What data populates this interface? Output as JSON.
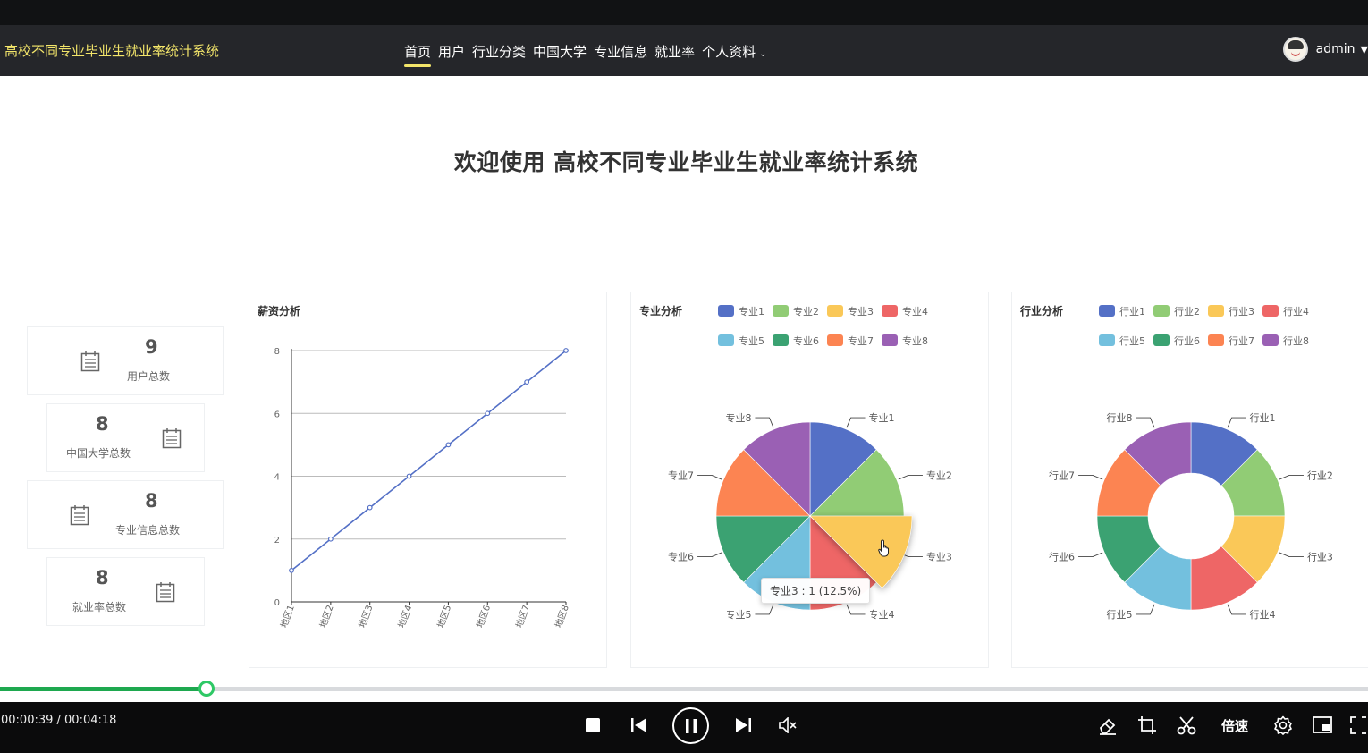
{
  "app": {
    "brand": "高校不同专业毕业生就业率统计系统",
    "welcome": "欢迎使用 高校不同专业毕业生就业率统计系统"
  },
  "nav": {
    "items": [
      "首页",
      "用户",
      "行业分类",
      "中国大学",
      "专业信息",
      "就业率",
      "个人资料"
    ],
    "active": "首页",
    "user": "admin"
  },
  "stats": [
    {
      "label": "用户总数",
      "value": "9",
      "icon": "calendar-icon"
    },
    {
      "label": "中国大学总数",
      "value": "8",
      "icon": "calendar-icon"
    },
    {
      "label": "专业信息总数",
      "value": "8",
      "icon": "calendar-icon"
    },
    {
      "label": "就业率总数",
      "value": "8",
      "icon": "calendar-icon"
    }
  ],
  "chart_data": [
    {
      "type": "line",
      "title": "薪资分析",
      "categories": [
        "地区1",
        "地区2",
        "地区3",
        "地区4",
        "地区5",
        "地区6",
        "地区7",
        "地区8"
      ],
      "values": [
        1,
        2,
        3,
        4,
        5,
        6,
        7,
        8
      ],
      "ylim": [
        0,
        8
      ],
      "yticks": [
        0,
        2,
        4,
        6,
        8
      ],
      "color": "#5470c6",
      "grid": true
    },
    {
      "type": "pie",
      "variant": "pie",
      "title": "专业分析",
      "categories": [
        "专业1",
        "专业2",
        "专业3",
        "专业4",
        "专业5",
        "专业6",
        "专业7",
        "专业8"
      ],
      "values": [
        1,
        1,
        1,
        1,
        1,
        1,
        1,
        1
      ],
      "colors": [
        "#5470c6",
        "#91cc75",
        "#fac858",
        "#ee6666",
        "#73c0de",
        "#3ba272",
        "#fc8452",
        "#9a60b4"
      ],
      "highlighted": "专业3",
      "tooltip": "专业3 : 1 (12.5%)",
      "legend": "top"
    },
    {
      "type": "pie",
      "variant": "donut",
      "title": "行业分析",
      "categories": [
        "行业1",
        "行业2",
        "行业3",
        "行业4",
        "行业5",
        "行业6",
        "行业7",
        "行业8"
      ],
      "values": [
        1,
        1,
        1,
        1,
        1,
        1,
        1,
        1
      ],
      "colors": [
        "#5470c6",
        "#91cc75",
        "#fac858",
        "#ee6666",
        "#73c0de",
        "#3ba272",
        "#fc8452",
        "#9a60b4"
      ],
      "legend": "top"
    }
  ],
  "player": {
    "time": "00:00:39 / 00:04:18",
    "progress": 0.151,
    "speed_label": "倍速"
  }
}
